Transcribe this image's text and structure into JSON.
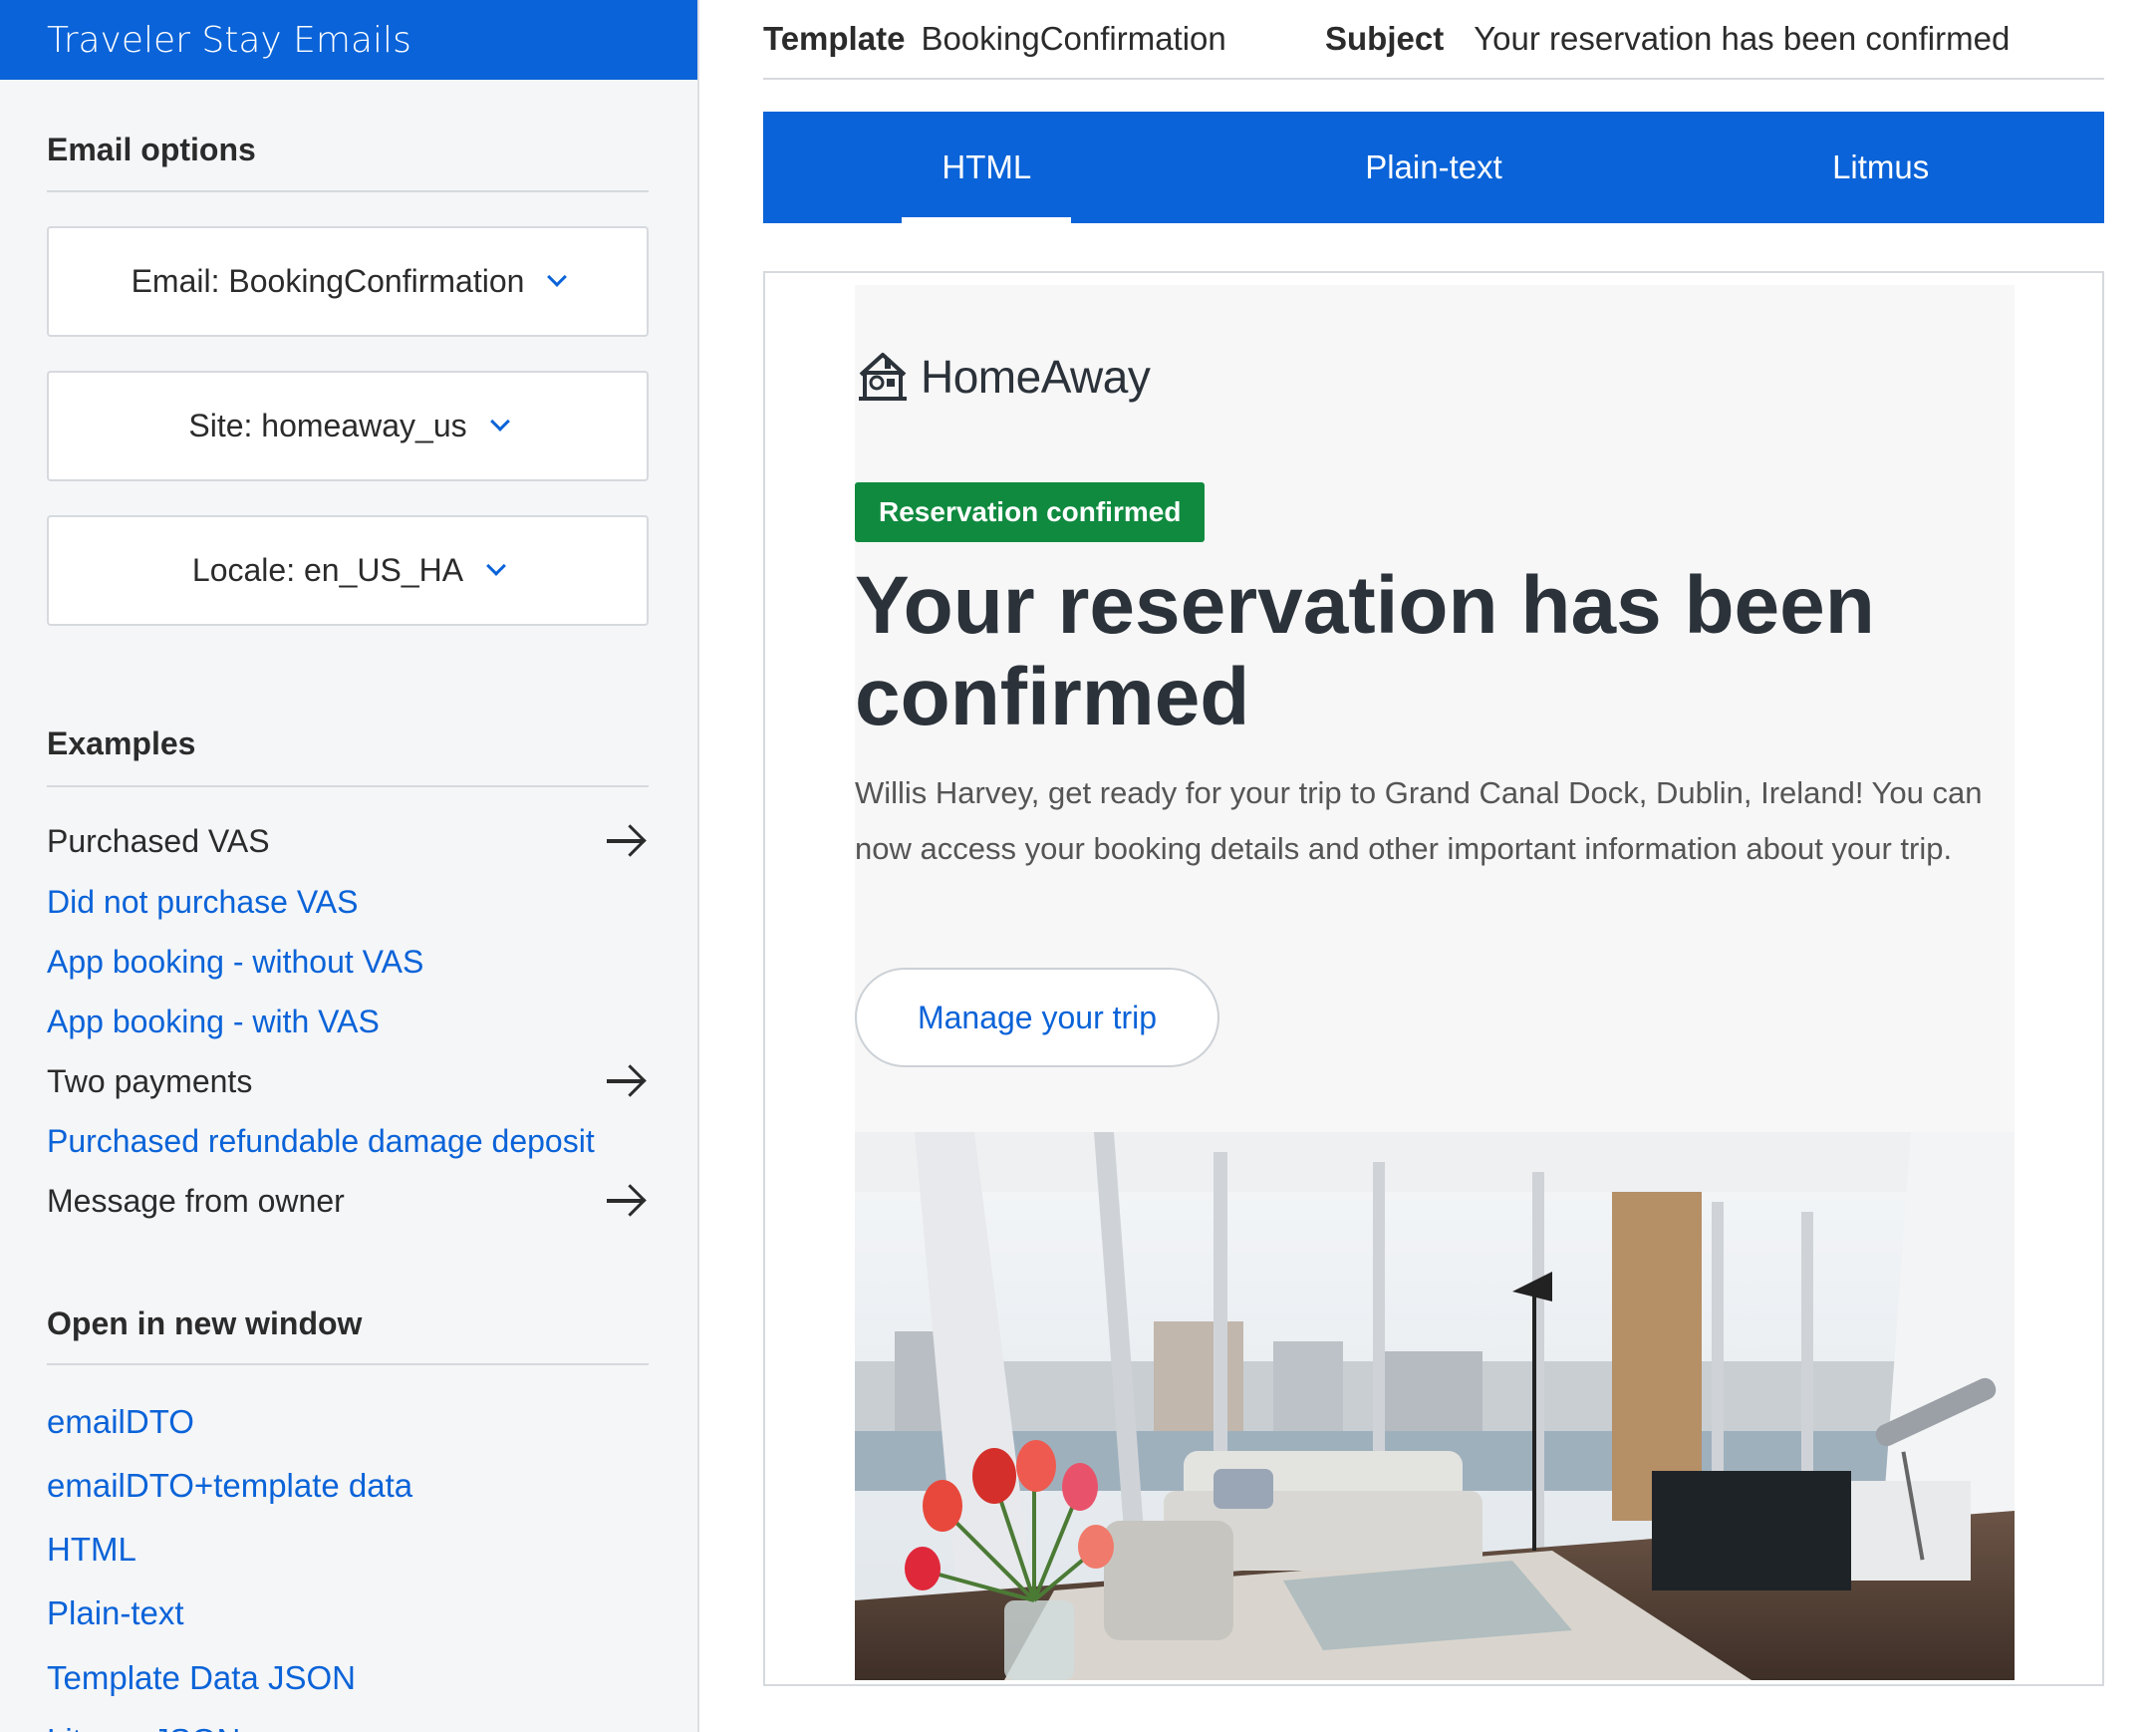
{
  "sidebar": {
    "title": "Traveler Stay Emails",
    "email_options": {
      "heading": "Email options",
      "email_select": "Email: BookingConfirmation",
      "site_select": "Site: homeaway_us",
      "locale_select": "Locale: en_US_HA"
    },
    "examples": {
      "heading": "Examples",
      "items": [
        {
          "label": "Purchased VAS",
          "state": "selected"
        },
        {
          "label": "Did not purchase VAS",
          "state": "link"
        },
        {
          "label": "App booking - without VAS",
          "state": "link"
        },
        {
          "label": "App booking - with VAS",
          "state": "link"
        },
        {
          "label": "Two payments",
          "state": "selected"
        },
        {
          "label": "Purchased refundable damage deposit",
          "state": "link"
        },
        {
          "label": "Message from owner",
          "state": "selected"
        }
      ]
    },
    "open_in_new_window": {
      "heading": "Open in new window",
      "links": [
        "emailDTO",
        "emailDTO+template data",
        "HTML",
        "Plain-text",
        "Template Data JSON",
        "Litmus JSON"
      ]
    }
  },
  "header": {
    "template_label": "Template",
    "template_value": "BookingConfirmation",
    "subject_label": "Subject",
    "subject_value": "Your reservation has been confirmed"
  },
  "tabs": [
    {
      "label": "HTML",
      "active": true
    },
    {
      "label": "Plain-text",
      "active": false
    },
    {
      "label": "Litmus",
      "active": false
    }
  ],
  "email": {
    "brand": "HomeAway",
    "badge": "Reservation confirmed",
    "headline": "Your reservation has been confirmed",
    "body": "Willis Harvey, get ready for your trip to Grand Canal Dock, Dublin, Ireland! You can now access your booking details and other important information about your trip.",
    "cta": "Manage your trip"
  },
  "colors": {
    "accent": "#0a63d8",
    "badge_green": "#108a3f",
    "sidebar_bg": "#f5f6f8"
  }
}
